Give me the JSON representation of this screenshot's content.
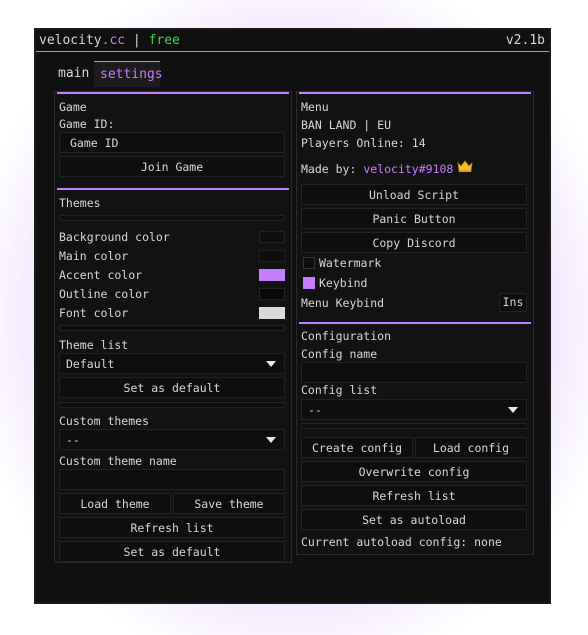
{
  "colors": {
    "accent": "#c77dff",
    "brand_green": "#3bd35a",
    "swatch_accent": "#c77dff",
    "swatch_font": "#d9d9d9",
    "swatch_dark": "#0e0e0e"
  },
  "titlebar": {
    "brand": "velocity",
    "brand_suffix": ".cc",
    "separator": " | ",
    "plan": "free",
    "version": "v2.1b"
  },
  "tabs": {
    "main": "main",
    "settings": "settings"
  },
  "game": {
    "heading": "Game",
    "id_label": "Game ID:",
    "id_placeholder": "Game ID",
    "join_label": "Join Game"
  },
  "themes": {
    "heading": "Themes",
    "background": "Background color",
    "main": "Main color",
    "accent": "Accent color",
    "outline": "Outline color",
    "font": "Font color",
    "theme_list_label": "Theme list",
    "theme_selected": "Default",
    "set_default": "Set as default",
    "custom_label": "Custom themes",
    "custom_selected": "--",
    "custom_name_label": "Custom theme name",
    "load_theme": "Load theme",
    "save_theme": "Save theme",
    "refresh": "Refresh list",
    "set_default2": "Set as default"
  },
  "menu": {
    "heading": "Menu",
    "server": "BAN LAND | EU",
    "players": "Players Online: 14",
    "made_by": "Made by:",
    "author": "velocity#9108",
    "crown_icon": "crown-icon",
    "unload": "Unload Script",
    "panic": "Panic Button",
    "copy_discord": "Copy Discord",
    "watermark": "Watermark",
    "watermark_checked": false,
    "keybind": "Keybind",
    "keybind_checked": true,
    "menu_keybind": "Menu Keybind",
    "menu_keybind_value": "Ins"
  },
  "config": {
    "heading": "Configuration",
    "name_label": "Config name",
    "list_label": "Config list",
    "list_selected": "--",
    "create": "Create config",
    "load": "Load config",
    "overwrite": "Overwrite config",
    "refresh": "Refresh list",
    "autoload": "Set as autoload",
    "current_label": "Current autoload config: ",
    "current_value": "none"
  }
}
